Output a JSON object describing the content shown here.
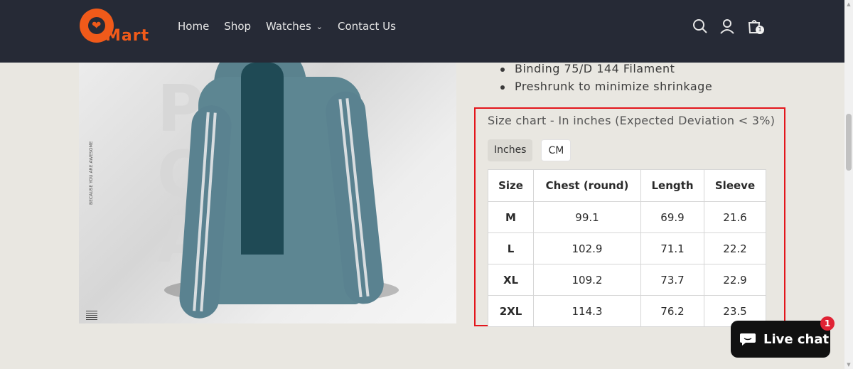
{
  "brand": {
    "logo_text": "Mart"
  },
  "nav": [
    {
      "label": "Home"
    },
    {
      "label": "Shop"
    },
    {
      "label": "Watches"
    },
    {
      "label": "Contact Us"
    }
  ],
  "header_icons": [
    "search-icon",
    "account-icon",
    "cart-icon"
  ],
  "cart": {
    "count": "1"
  },
  "product_image": {
    "side_text": "BECAUSE YOU ARE AWESOME"
  },
  "details": {
    "bullets": [
      "Binding 75/D 144 Filament",
      "Preshrunk to minimize shrinkage"
    ]
  },
  "size_chart": {
    "title": "Size chart - In inches (Expected Deviation < 3%)",
    "tabs": [
      {
        "label": "Inches",
        "active": true
      },
      {
        "label": "CM",
        "active": false
      }
    ],
    "headers": [
      "Size",
      "Chest (round)",
      "Length",
      "Sleeve"
    ],
    "rows": [
      [
        "M",
        "99.1",
        "69.9",
        "21.6"
      ],
      [
        "L",
        "102.9",
        "71.1",
        "22.2"
      ],
      [
        "XL",
        "109.2",
        "73.7",
        "22.9"
      ],
      [
        "2XL",
        "114.3",
        "76.2",
        "23.5"
      ]
    ]
  },
  "live_chat": {
    "label": "Live chat",
    "badge": "1"
  },
  "colors": {
    "header_bg": "#262a36",
    "brand_orange": "#f05a1a",
    "highlight_border": "#e3161c",
    "chat_bg": "#111111",
    "badge_red": "#e02334"
  }
}
